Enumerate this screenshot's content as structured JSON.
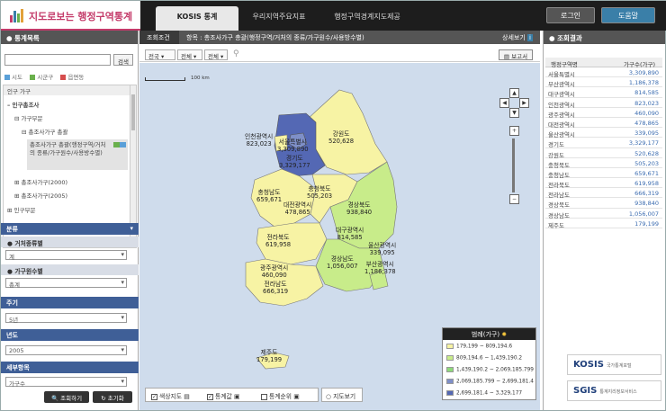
{
  "app": {
    "title": "지도로보는 행정구역통계"
  },
  "top_tabs": [
    {
      "label": "KOSIS 통계"
    },
    {
      "label": "우리지역주요지표"
    },
    {
      "label": "행정구역경계지도제공"
    }
  ],
  "header_buttons": {
    "login": "로그인",
    "help": "도움말"
  },
  "left": {
    "panel_title": "통계목록",
    "search_button": "검색",
    "legend": [
      "시도",
      "시군구",
      "읍면동"
    ],
    "tree": [
      "인구 가구",
      "인구총조사",
      "가구부문",
      "총조사가구 총괄",
      "총조사가구 총괄(행정구역/거처의 종류/가구원수/사용방수별)",
      "총조사가구(2000)",
      "총조사가구(2005)",
      "인구부문"
    ],
    "sections": {
      "class": "분류",
      "housing": "거처종류별",
      "housing_value": "계",
      "members": "가구원수별",
      "members_value": "총계",
      "period": "주기",
      "period_value": "5년",
      "year": "년도",
      "year_value": "2005",
      "item": "세부항목",
      "item_value": "가구수"
    },
    "buttons": {
      "query": "조회하기",
      "reset": "초기화"
    }
  },
  "middle": {
    "cond_tab": "조회조건",
    "breadcrumb": "항목 : 총조사가구 총괄(행정구역/거처의 종류/가구원수/사용방수별)",
    "detail": "상세보기",
    "selects": [
      "전국",
      "전체",
      "전체"
    ],
    "report": "보고서",
    "scale_label": "100 km",
    "legend_title": "범례(가구)",
    "legend_rows": [
      {
        "label": "179,199 ~ 809,194.6",
        "color": "#f7f3a4"
      },
      {
        "label": "809,194.6 ~ 1,439,190.2",
        "color": "#c8ec8a"
      },
      {
        "label": "1,439,190.2 ~ 2,069,185.799",
        "color": "#8ed97a"
      },
      {
        "label": "2,069,185.799 ~ 2,699,181.4",
        "color": "#7e8fc8"
      },
      {
        "label": "2,699,181.4 ~ 3,329,177",
        "color": "#5468b4"
      }
    ],
    "options": {
      "opt1": "색상지도",
      "opt2": "통계값",
      "opt3": "통계순위",
      "mapview": "지도보기"
    },
    "regions": [
      {
        "name": "인천광역시",
        "value": "823,023"
      },
      {
        "name": "서울특별시",
        "value": "3,309,890"
      },
      {
        "name": "경기도",
        "value": "3,329,177"
      },
      {
        "name": "강원도",
        "value": "520,628"
      },
      {
        "name": "충청남도",
        "value": "659,671"
      },
      {
        "name": "충청북도",
        "value": "505,203"
      },
      {
        "name": "대전광역시",
        "value": "478,865"
      },
      {
        "name": "경상북도",
        "value": "938,840"
      },
      {
        "name": "전라북도",
        "value": "619,958"
      },
      {
        "name": "대구광역시",
        "value": "814,585"
      },
      {
        "name": "울산광역시",
        "value": "339,095"
      },
      {
        "name": "경상남도",
        "value": "1,056,007"
      },
      {
        "name": "부산광역시",
        "value": "1,186,378"
      },
      {
        "name": "광주광역시",
        "value": "460,090"
      },
      {
        "name": "전라남도",
        "value": "666,319"
      },
      {
        "name": "제주도",
        "value": "179,199"
      }
    ]
  },
  "right": {
    "panel_title": "조회결과",
    "col1": "행정구역명",
    "col2": "가구수(가구)",
    "rows": [
      [
        "서울특별시",
        "3,309,890"
      ],
      [
        "부산광역시",
        "1,186,378"
      ],
      [
        "대구광역시",
        "814,585"
      ],
      [
        "인천광역시",
        "823,023"
      ],
      [
        "광주광역시",
        "460,090"
      ],
      [
        "대전광역시",
        "478,865"
      ],
      [
        "울산광역시",
        "339,095"
      ],
      [
        "경기도",
        "3,329,177"
      ],
      [
        "강원도",
        "520,628"
      ],
      [
        "충청북도",
        "505,203"
      ],
      [
        "충청남도",
        "659,671"
      ],
      [
        "전라북도",
        "619,958"
      ],
      [
        "전라남도",
        "666,319"
      ],
      [
        "경상북도",
        "938,840"
      ],
      [
        "경상남도",
        "1,056,007"
      ],
      [
        "제주도",
        "179,199"
      ]
    ],
    "brand1": "KOSIS",
    "brand1_sub": "국가통계포털",
    "brand2": "SGIS",
    "brand2_sub": "통계지리정보서비스"
  }
}
